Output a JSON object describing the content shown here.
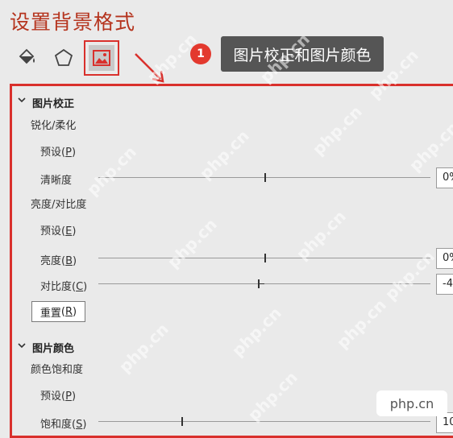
{
  "pane_title": "设置背景格式",
  "tabs": [
    {
      "icon": "fill-bucket-icon"
    },
    {
      "icon": "pentagon-shape-icon"
    },
    {
      "icon": "picture-icon",
      "selected": true
    }
  ],
  "annotation": {
    "number": "1",
    "text": "图片校正和图片颜色"
  },
  "correction": {
    "header": "图片校正",
    "sharpen_group": "锐化/柔化",
    "sharpen_preset": {
      "label": "预设",
      "key": "(P)",
      "key_letter": "P"
    },
    "sharpness": {
      "label": "清晰度",
      "value": "0%",
      "fraction": 0.5
    },
    "brightness_group": "亮度/对比度",
    "bc_preset": {
      "label": "预设",
      "key": "(E)",
      "key_letter": "E"
    },
    "brightness": {
      "label": "亮度",
      "key_letter": "B",
      "value": "0%",
      "fraction": 0.5
    },
    "contrast": {
      "label": "对比度",
      "key_letter": "C",
      "value": "-4",
      "fraction": 0.48
    },
    "reset": {
      "label": "重置",
      "key_letter": "R"
    }
  },
  "color": {
    "header": "图片颜色",
    "saturation_group": "颜色饱和度",
    "sat_preset": {
      "label": "预设",
      "key_letter": "P"
    },
    "saturation": {
      "label": "饱和度",
      "key_letter": "S",
      "value": "10",
      "fraction": 0.25
    }
  },
  "watermark": "php.cn",
  "logo": "php.cn"
}
